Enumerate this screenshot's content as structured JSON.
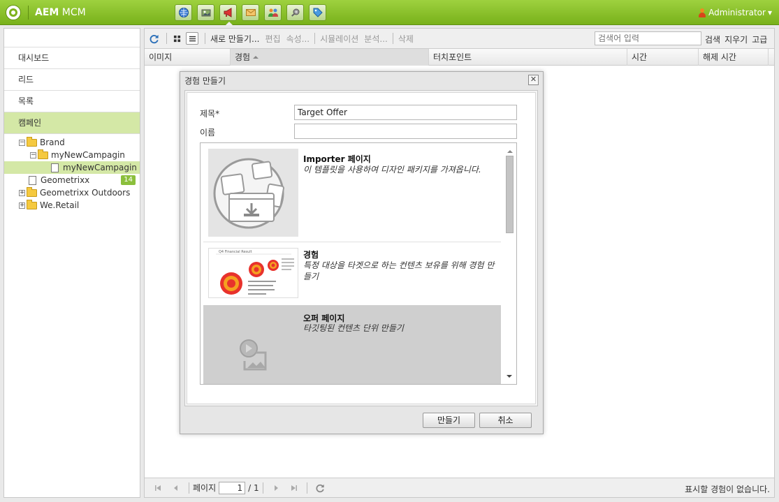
{
  "app": {
    "brand": "AEM",
    "title": "MCM"
  },
  "header": {
    "nav_icons": [
      "globe-icon",
      "gallery-icon",
      "campaign-icon",
      "mail-icon",
      "users-icon",
      "tools-icon",
      "tag-icon"
    ],
    "user": "Administrator"
  },
  "sidebar": {
    "items": [
      {
        "label": "대시보드"
      },
      {
        "label": "리드"
      },
      {
        "label": "목록"
      },
      {
        "label": "캠페인"
      }
    ],
    "tree": [
      {
        "label": "Brand"
      },
      {
        "label": "myNewCampagin"
      },
      {
        "label": "myNewCampagin"
      },
      {
        "label": "Geometrixx",
        "badge": "14"
      },
      {
        "label": "Geometrixx Outdoors"
      },
      {
        "label": "We.Retail"
      }
    ]
  },
  "toolbar": {
    "new": "새로 만들기...",
    "edit": "편집",
    "properties": "속성...",
    "simulate": "시뮬레이션",
    "analyze": "분석...",
    "delete": "삭제",
    "search_placeholder": "검색어 입력",
    "search": "검색",
    "clear": "지우기",
    "advanced": "고급"
  },
  "grid": {
    "columns": [
      "이미지",
      "경험",
      "터치포인트",
      "시간",
      "해제 시간"
    ]
  },
  "footer": {
    "page_label": "페이지",
    "page_value": "1",
    "page_total": "/ 1",
    "status": "표시할 경험이 없습니다."
  },
  "dialog": {
    "title": "경험 만들기",
    "close": "✕",
    "title_label": "제목*",
    "title_value": "Target Offer",
    "name_label": "이름",
    "name_value": "",
    "templates": [
      {
        "title": "Importer 페이지",
        "description": "이 템플릿을 사용하여 디자인 패키지를 가져옵니다."
      },
      {
        "title": "경험",
        "description": "특정 대상을 타겟으로 하는 컨텐츠 보유를 위해 경험 만들기",
        "thumb_text": "Q4 Financial Result"
      },
      {
        "title": "오퍼 페이지",
        "description": "타깃팅된 컨텐츠 단위 만들기"
      }
    ],
    "create": "만들기",
    "cancel": "취소"
  }
}
